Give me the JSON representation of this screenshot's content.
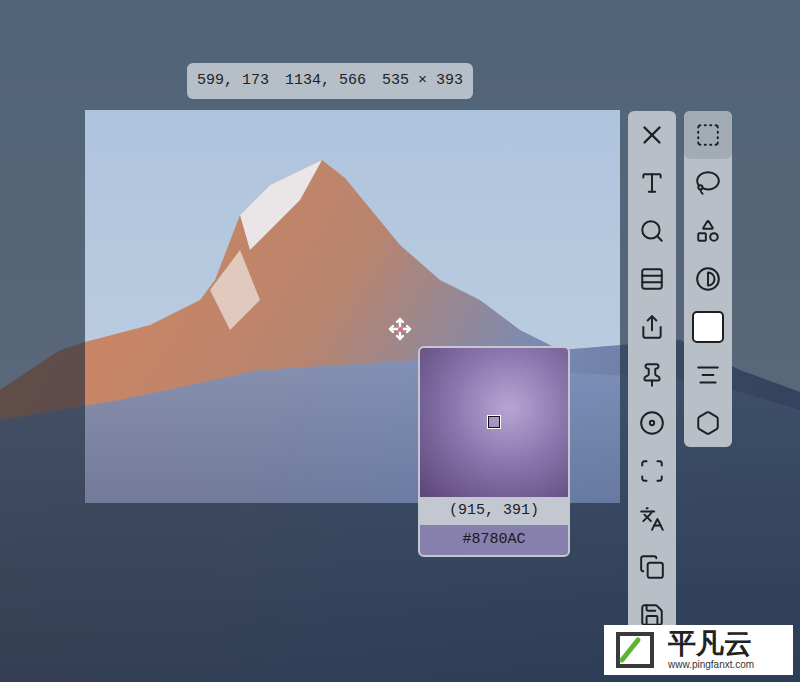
{
  "selection_info": {
    "start": "599, 173",
    "end": "1134, 566",
    "size": "535 × 393"
  },
  "shape_tools": [
    {
      "selected": true
    },
    {
      "selected": false
    },
    {
      "selected": false
    },
    {
      "selected": false
    },
    {
      "selected": false
    },
    {
      "selected": false
    },
    {
      "selected": false
    }
  ],
  "stroke_color": "#ffffff",
  "magnifier": {
    "coords": "(915, 391)",
    "hex": "#8780AC"
  },
  "watermark": {
    "name": "平凡云",
    "url": "www.pingfanxt.com"
  }
}
